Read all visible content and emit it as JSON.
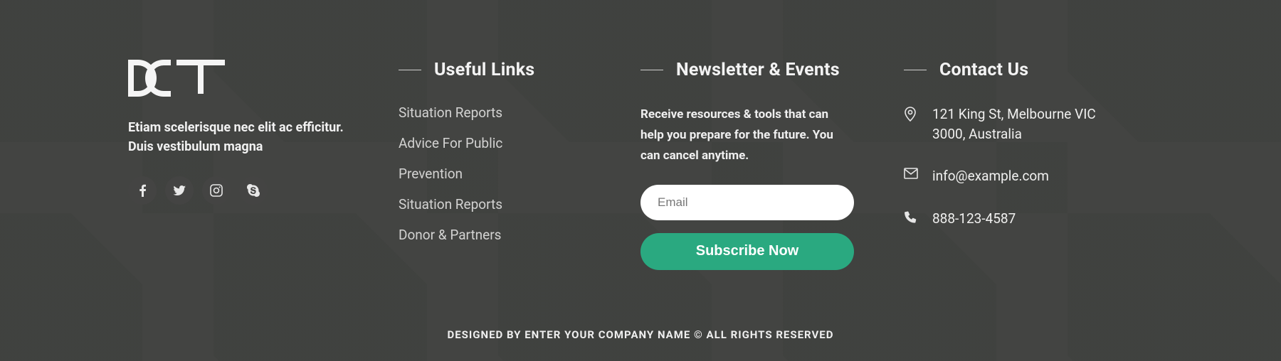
{
  "brand": {
    "name": "DCT"
  },
  "tagline": "Etiam scelerisque nec elit ac efficitur. Duis vestibulum magna",
  "socials": [
    {
      "name": "facebook-icon"
    },
    {
      "name": "twitter-icon"
    },
    {
      "name": "instagram-icon"
    },
    {
      "name": "skype-icon"
    }
  ],
  "useful_links": {
    "title": "Useful Links",
    "items": [
      "Situation Reports",
      "Advice For Public",
      "Prevention",
      "Situation Reports",
      "Donor & Partners"
    ]
  },
  "newsletter": {
    "title": "Newsletter & Events",
    "description": "Receive resources & tools that can help you prepare for the future. You can cancel anytime.",
    "placeholder": "Email",
    "button": "Subscribe Now"
  },
  "contact": {
    "title": "Contact Us",
    "address": "121 King St, Melbourne VIC 3000, Australia",
    "email": "info@example.com",
    "phone": "888-123-4587"
  },
  "copyright": "Designed by Enter Your Company Name © All Rights Reserved"
}
